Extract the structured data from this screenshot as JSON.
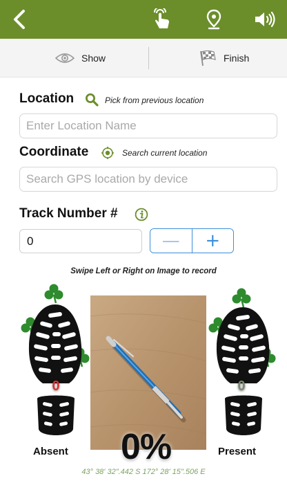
{
  "toolbar": {
    "back_icon": "chevron-left-icon",
    "hand_icon": "tap-hand-icon",
    "pin_icon": "location-pin-icon",
    "sound_icon": "speaker-icon",
    "bar_color": "#6b8e2b"
  },
  "actions": {
    "show_label": "Show",
    "finish_label": "Finish"
  },
  "location": {
    "label": "Location",
    "hint": "Pick from previous location",
    "placeholder": "Enter Location Name",
    "value": ""
  },
  "coordinate": {
    "label": "Coordinate",
    "hint": "Search current location",
    "placeholder": "Search GPS location by device",
    "value": ""
  },
  "track": {
    "label": "Track Number #",
    "value": "0",
    "minus": "—",
    "plus": "+"
  },
  "record": {
    "swipe_hint": "Swipe Left or Right on Image to record",
    "absent_label": "Absent",
    "absent_count": "0",
    "present_label": "Present",
    "present_count": "0",
    "percent": "0%",
    "coordinates": "43° 38' 32\".442 S 172° 28' 15\".506 E"
  },
  "colors": {
    "accent": "#6b8e2b",
    "stepper": "#3a8edb",
    "absent": "#e03030",
    "coords": "#7da463"
  }
}
